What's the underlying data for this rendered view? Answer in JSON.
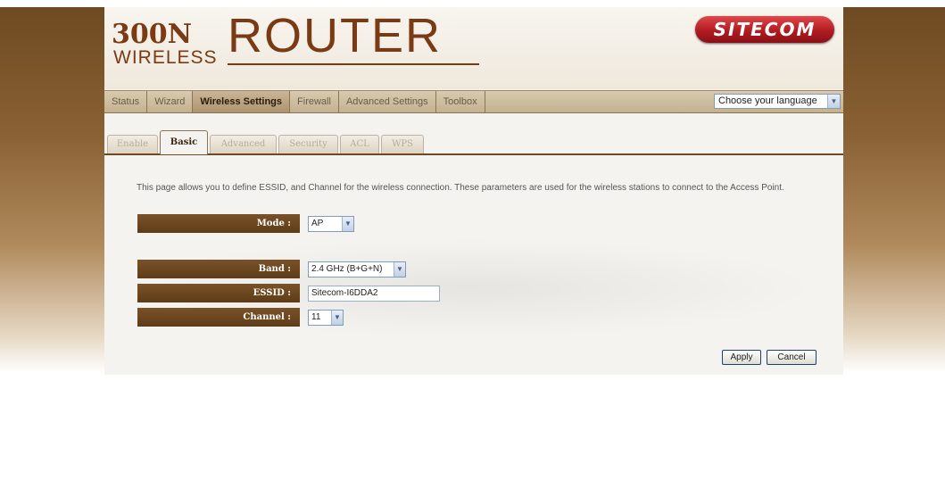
{
  "header": {
    "logo_300n": "300N",
    "logo_wireless": "WIRELESS",
    "logo_router": "ROUTER",
    "brand": "SITECOM"
  },
  "menu": {
    "items": [
      {
        "label": "Status"
      },
      {
        "label": "Wizard"
      },
      {
        "label": "Wireless Settings"
      },
      {
        "label": "Firewall"
      },
      {
        "label": "Advanced Settings"
      },
      {
        "label": "Toolbox"
      }
    ],
    "language_select": "Choose your language"
  },
  "tabs": [
    {
      "label": "Enable"
    },
    {
      "label": "Basic"
    },
    {
      "label": "Advanced"
    },
    {
      "label": "Security"
    },
    {
      "label": "ACL"
    },
    {
      "label": "WPS"
    }
  ],
  "description": "This page allows you to define ESSID, and Channel for the wireless connection. These parameters are used for the wireless stations to connect to the Access Point.",
  "form": {
    "mode": {
      "label": "Mode :",
      "value": "AP"
    },
    "band": {
      "label": "Band :",
      "value": "2.4 GHz (B+G+N)"
    },
    "essid": {
      "label": "ESSID :",
      "value": "Sitecom-I6DDA2"
    },
    "channel": {
      "label": "Channel :",
      "value": "11"
    }
  },
  "buttons": {
    "apply": "Apply",
    "cancel": "Cancel"
  }
}
